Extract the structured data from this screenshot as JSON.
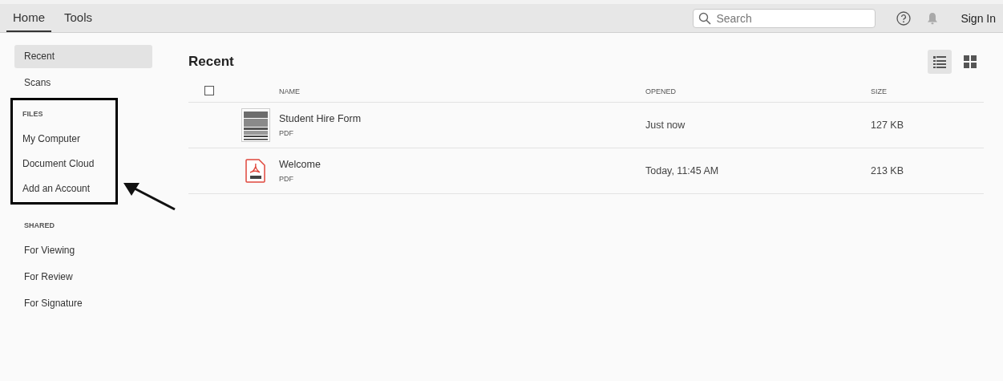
{
  "tabs": [
    {
      "label": "Home",
      "selected": true
    },
    {
      "label": "Tools",
      "selected": false
    }
  ],
  "search": {
    "placeholder": "Search"
  },
  "sign_in": "Sign In",
  "sidebar": {
    "items": [
      {
        "label": "Recent",
        "selected": true
      },
      {
        "label": "Scans",
        "selected": false
      }
    ],
    "sections": [
      {
        "heading": "FILES",
        "highlighted": true,
        "items": [
          {
            "label": "My Computer",
            "selected": false
          },
          {
            "label": "Document Cloud",
            "selected": false
          },
          {
            "label": "Add an Account",
            "selected": false
          }
        ]
      },
      {
        "heading": "SHARED",
        "items": [
          {
            "label": "For Viewing",
            "selected": false
          },
          {
            "label": "For Review",
            "selected": false
          },
          {
            "label": "For Signature",
            "selected": false
          }
        ]
      }
    ]
  },
  "main": {
    "title": "Recent",
    "views": [
      {
        "kind": "list",
        "selected": true
      },
      {
        "kind": "grid",
        "selected": false
      }
    ],
    "table": {
      "select_all_checked": false,
      "columns": [
        "NAME",
        "OPENED",
        "SIZE"
      ],
      "rows": [
        {
          "kind": "scan",
          "name": "Student Hire Form",
          "type": "PDF",
          "opened": "Just now",
          "size": "127 KB"
        },
        {
          "kind": "pdf",
          "name": "Welcome",
          "type": "PDF",
          "opened": "Today, 11:45 AM",
          "size": "213 KB"
        }
      ]
    }
  }
}
